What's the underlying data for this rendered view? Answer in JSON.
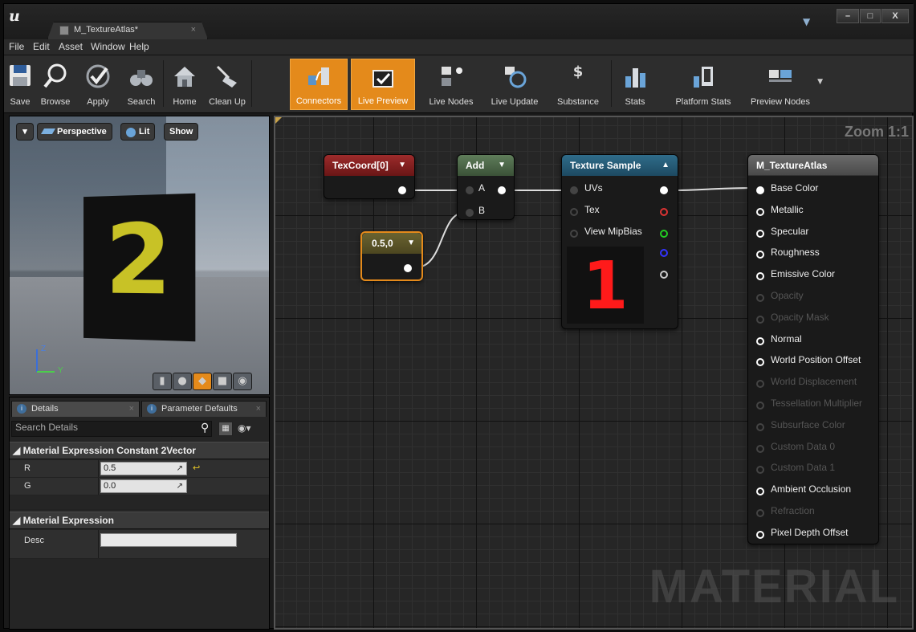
{
  "window": {
    "tab_title": "M_TextureAtlas*",
    "tab_close": "×",
    "controls": {
      "minimize": "–",
      "maximize": "□",
      "close": "X"
    }
  },
  "menu": [
    "File",
    "Edit",
    "Asset",
    "Window",
    "Help"
  ],
  "toolbar": [
    {
      "label": "Save",
      "icon": "save-icon"
    },
    {
      "label": "Browse",
      "icon": "browse-icon"
    },
    {
      "label": "Apply",
      "icon": "apply-icon"
    },
    {
      "label": "Search",
      "icon": "binoculars-icon"
    },
    {
      "label": "Home",
      "icon": "home-icon"
    },
    {
      "label": "Clean Up",
      "icon": "broom-icon"
    },
    {
      "label": "Connectors",
      "icon": "connectors-icon",
      "active": true
    },
    {
      "label": "Live Preview",
      "icon": "live-preview-icon",
      "active": true
    },
    {
      "label": "Live Nodes",
      "icon": "live-nodes-icon"
    },
    {
      "label": "Live Update",
      "icon": "live-update-icon"
    },
    {
      "label": "Substance",
      "icon": "substance-icon"
    },
    {
      "label": "Stats",
      "icon": "stats-icon"
    },
    {
      "label": "Platform Stats",
      "icon": "platform-stats-icon"
    },
    {
      "label": "Preview Nodes",
      "icon": "preview-nodes-icon"
    }
  ],
  "viewport": {
    "dropdown": "▾",
    "perspective": "Perspective",
    "lit": "Lit",
    "show": "Show",
    "preview_text": "2",
    "axis_z": "Z",
    "axis_y": "Y"
  },
  "details": {
    "tab_details": "Details",
    "tab_params": "Parameter Defaults",
    "search_placeholder": "Search Details",
    "section1": "Material Expression Constant 2Vector",
    "r_label": "R",
    "r_value": "0.5",
    "g_label": "G",
    "g_value": "0.0",
    "section2": "Material Expression",
    "desc_label": "Desc",
    "desc_value": ""
  },
  "graph": {
    "zoom": "Zoom 1:1",
    "watermark": "MATERIAL",
    "texcoord_title": "TexCoord[0]",
    "add_title": "Add",
    "add_pin_a": "A",
    "add_pin_b": "B",
    "const_title": "0.5,0",
    "texsample_title": "Texture Sample",
    "texsample_uvs": "UVs",
    "texsample_tex": "Tex",
    "texsample_mip": "View MipBias",
    "texsample_preview_text": "1",
    "result_title": "M_TextureAtlas",
    "result_pins": [
      {
        "label": "Base Color",
        "enabled": true
      },
      {
        "label": "Metallic",
        "enabled": true
      },
      {
        "label": "Specular",
        "enabled": true
      },
      {
        "label": "Roughness",
        "enabled": true
      },
      {
        "label": "Emissive Color",
        "enabled": true
      },
      {
        "label": "Opacity",
        "enabled": false
      },
      {
        "label": "Opacity Mask",
        "enabled": false
      },
      {
        "label": "Normal",
        "enabled": true
      },
      {
        "label": "World Position Offset",
        "enabled": true
      },
      {
        "label": "World Displacement",
        "enabled": false
      },
      {
        "label": "Tessellation Multiplier",
        "enabled": false
      },
      {
        "label": "Subsurface Color",
        "enabled": false
      },
      {
        "label": "Custom Data 0",
        "enabled": false
      },
      {
        "label": "Custom Data 1",
        "enabled": false
      },
      {
        "label": "Ambient Occlusion",
        "enabled": true
      },
      {
        "label": "Refraction",
        "enabled": false
      },
      {
        "label": "Pixel Depth Offset",
        "enabled": true
      }
    ]
  }
}
